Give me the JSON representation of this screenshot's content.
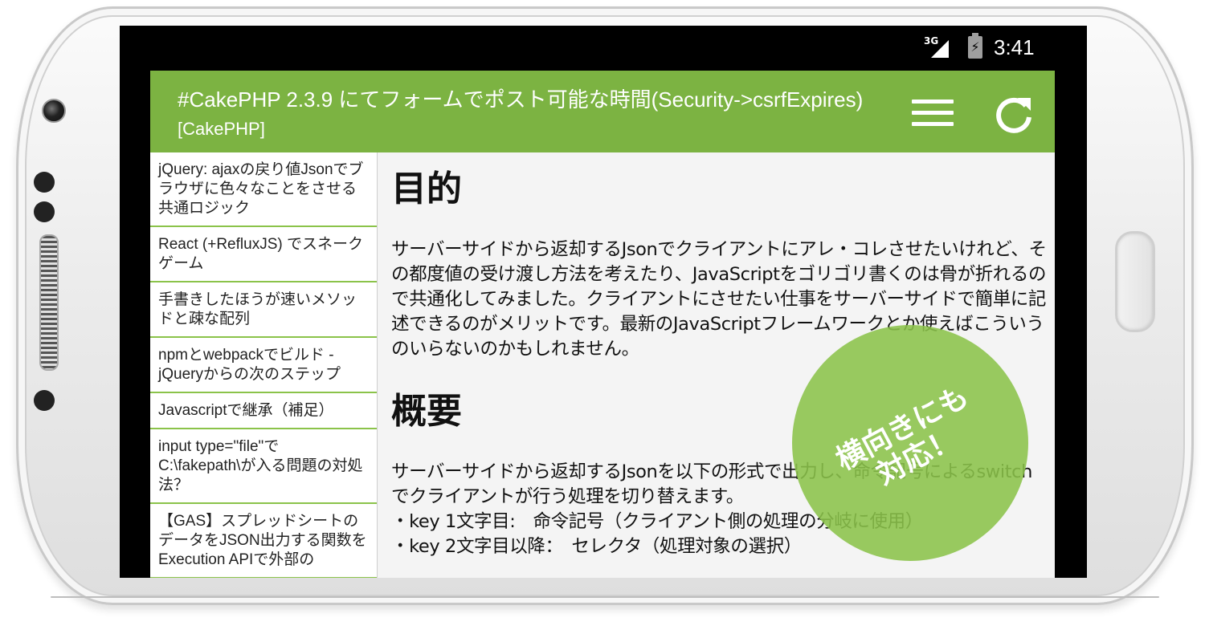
{
  "status_bar": {
    "network": "3G",
    "time": "3:41",
    "icons": [
      "signal-icon",
      "battery-charging-icon"
    ]
  },
  "app_bar": {
    "title": "#CakePHP 2.3.9 にてフォームでポスト可能な時間(Security->csrfExpires)",
    "subtitle": "[CakePHP]",
    "icons": [
      "menu-icon",
      "refresh-icon"
    ],
    "color": "#7cb342"
  },
  "sidebar": {
    "items": [
      {
        "label": "jQuery: ajaxの戻り値Jsonでブラウザに色々なことをさせる共通ロジック"
      },
      {
        "label": "React (+RefluxJS) でスネークゲーム"
      },
      {
        "label": "手書きしたほうが速いメソッドと疎な配列"
      },
      {
        "label": "npmとwebpackでビルド - jQueryからの次のステップ"
      },
      {
        "label": "Javascriptで継承（補足）"
      },
      {
        "label": "input type=\"file\"でC:\\fakepath\\が入る問題の対処法？"
      },
      {
        "label": "【GAS】スプレッドシートのデータをJSON出力する関数をExecution APIで外部の"
      }
    ]
  },
  "article": {
    "heading1": "目的",
    "paragraph1": "サーバーサイドから返却するJsonでクライアントにアレ・コレさせたいけれど、その都度値の受け渡し方法を考えたり、JavaScriptをゴリゴリ書くのは骨が折れるので共通化してみました。クライアントにさせたい仕事をサーバーサイドで簡単に記述できるのがメリットです。最新のJavaScriptフレームワークとか使えばこういうのいらないのかもしれません。",
    "heading2": "概要",
    "paragraph2": "サーバーサイドから返却するJsonを以下の形式で出力し、命令記号によるswitchでクライアントが行う処理を切り替えます。",
    "bullets": [
      "・key 1文字目:　命令記号（クライアント側の処理の分岐に使用）",
      "・key 2文字目以降：　セレクタ（処理対象の選択）"
    ]
  },
  "badge": {
    "line1": "横向きにも",
    "line2": "対応！",
    "color": "#8bc34a"
  }
}
